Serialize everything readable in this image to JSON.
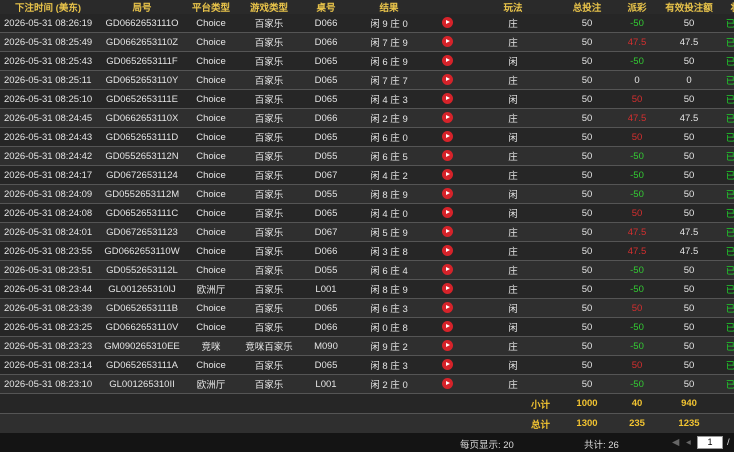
{
  "columns": [
    "下注时间 (美东)",
    "局号",
    "平台类型",
    "游戏类型",
    "桌号",
    "结果",
    "",
    "玩法",
    "总投注",
    "派彩",
    "有效投注额",
    "状态"
  ],
  "rows": [
    {
      "time": "2026-05-31 08:26:19",
      "round": "GD0662653111O",
      "platform": "Choice",
      "game": "百家乐",
      "table": "D066",
      "result": "闲 9 庄 0",
      "play": "庄",
      "bet": "50",
      "payout": "-50",
      "payout_sign": "pos",
      "valid": "50",
      "status": "已派彩"
    },
    {
      "time": "2026-05-31 08:25:49",
      "round": "GD0662653110Z",
      "platform": "Choice",
      "game": "百家乐",
      "table": "D066",
      "result": "闲 7 庄 9",
      "play": "庄",
      "bet": "50",
      "payout": "47.5",
      "payout_sign": "neg",
      "valid": "47.5",
      "status": "已派彩"
    },
    {
      "time": "2026-05-31 08:25:43",
      "round": "GD0652653111F",
      "platform": "Choice",
      "game": "百家乐",
      "table": "D065",
      "result": "闲 6 庄 9",
      "play": "闲",
      "bet": "50",
      "payout": "-50",
      "payout_sign": "pos",
      "valid": "50",
      "status": "已派彩"
    },
    {
      "time": "2026-05-31 08:25:11",
      "round": "GD0652653110Y",
      "platform": "Choice",
      "game": "百家乐",
      "table": "D065",
      "result": "闲 7 庄 7",
      "play": "庄",
      "bet": "50",
      "payout": "0",
      "payout_sign": "zero",
      "valid": "0",
      "status": "已派彩"
    },
    {
      "time": "2026-05-31 08:25:10",
      "round": "GD0652653111E",
      "platform": "Choice",
      "game": "百家乐",
      "table": "D065",
      "result": "闲 4 庄 3",
      "play": "闲",
      "bet": "50",
      "payout": "50",
      "payout_sign": "neg",
      "valid": "50",
      "status": "已派彩"
    },
    {
      "time": "2026-05-31 08:24:45",
      "round": "GD0662653110X",
      "platform": "Choice",
      "game": "百家乐",
      "table": "D066",
      "result": "闲 2 庄 9",
      "play": "庄",
      "bet": "50",
      "payout": "47.5",
      "payout_sign": "neg",
      "valid": "47.5",
      "status": "已派彩"
    },
    {
      "time": "2026-05-31 08:24:43",
      "round": "GD0652653111D",
      "platform": "Choice",
      "game": "百家乐",
      "table": "D065",
      "result": "闲 6 庄 0",
      "play": "闲",
      "bet": "50",
      "payout": "50",
      "payout_sign": "neg",
      "valid": "50",
      "status": "已派彩"
    },
    {
      "time": "2026-05-31 08:24:42",
      "round": "GD0552653112N",
      "platform": "Choice",
      "game": "百家乐",
      "table": "D055",
      "result": "闲 6 庄 5",
      "play": "庄",
      "bet": "50",
      "payout": "-50",
      "payout_sign": "pos",
      "valid": "50",
      "status": "已派彩"
    },
    {
      "time": "2026-05-31 08:24:17",
      "round": "GD0672653112​4",
      "platform": "Choice",
      "game": "百家乐",
      "table": "D067",
      "result": "闲 4 庄 2",
      "play": "庄",
      "bet": "50",
      "payout": "-50",
      "payout_sign": "pos",
      "valid": "50",
      "status": "已派彩"
    },
    {
      "time": "2026-05-31 08:24:09",
      "round": "GD0552653112M",
      "platform": "Choice",
      "game": "百家乐",
      "table": "D055",
      "result": "闲 8 庄 9",
      "play": "闲",
      "bet": "50",
      "payout": "-50",
      "payout_sign": "pos",
      "valid": "50",
      "status": "已派彩"
    },
    {
      "time": "2026-05-31 08:24:08",
      "round": "GD0652653111C",
      "platform": "Choice",
      "game": "百家乐",
      "table": "D065",
      "result": "闲 4 庄 0",
      "play": "闲",
      "bet": "50",
      "payout": "50",
      "payout_sign": "neg",
      "valid": "50",
      "status": "已派彩"
    },
    {
      "time": "2026-05-31 08:24:01",
      "round": "GD0672653112​3",
      "platform": "Choice",
      "game": "百家乐",
      "table": "D067",
      "result": "闲 5 庄 9",
      "play": "庄",
      "bet": "50",
      "payout": "47.5",
      "payout_sign": "neg",
      "valid": "47.5",
      "status": "已派彩"
    },
    {
      "time": "2026-05-31 08:23:55",
      "round": "GD0662653110W",
      "platform": "Choice",
      "game": "百家乐",
      "table": "D066",
      "result": "闲 3 庄 8",
      "play": "庄",
      "bet": "50",
      "payout": "47.5",
      "payout_sign": "neg",
      "valid": "47.5",
      "status": "已派彩"
    },
    {
      "time": "2026-05-31 08:23:51",
      "round": "GD0552653112L",
      "platform": "Choice",
      "game": "百家乐",
      "table": "D055",
      "result": "闲 6 庄 4",
      "play": "庄",
      "bet": "50",
      "payout": "-50",
      "payout_sign": "pos",
      "valid": "50",
      "status": "已派彩"
    },
    {
      "time": "2026-05-31 08:23:44",
      "round": "GL00126531​0IJ",
      "platform": "欧洲厅",
      "game": "百家乐",
      "table": "L001",
      "result": "闲 8 庄 9",
      "play": "庄",
      "bet": "50",
      "payout": "-50",
      "payout_sign": "pos",
      "valid": "50",
      "status": "已派彩"
    },
    {
      "time": "2026-05-31 08:23:39",
      "round": "GD0652653111B",
      "platform": "Choice",
      "game": "百家乐",
      "table": "D065",
      "result": "闲 6 庄 3",
      "play": "闲",
      "bet": "50",
      "payout": "50",
      "payout_sign": "neg",
      "valid": "50",
      "status": "已派彩"
    },
    {
      "time": "2026-05-31 08:23:25",
      "round": "GD0662653110V",
      "platform": "Choice",
      "game": "百家乐",
      "table": "D066",
      "result": "闲 0 庄 8",
      "play": "闲",
      "bet": "50",
      "payout": "-50",
      "payout_sign": "pos",
      "valid": "50",
      "status": "已派彩"
    },
    {
      "time": "2026-05-31 08:23:23",
      "round": "GM0902653​10EE",
      "platform": "竞咪",
      "game": "竞咪百家乐",
      "table": "M090",
      "result": "闲 9 庄 2",
      "play": "庄",
      "bet": "50",
      "payout": "-50",
      "payout_sign": "pos",
      "valid": "50",
      "status": "已派彩"
    },
    {
      "time": "2026-05-31 08:23:14",
      "round": "GD0652653111A",
      "platform": "Choice",
      "game": "百家乐",
      "table": "D065",
      "result": "闲 8 庄 3",
      "play": "闲",
      "bet": "50",
      "payout": "50",
      "payout_sign": "neg",
      "valid": "50",
      "status": "已派彩"
    },
    {
      "time": "2026-05-31 08:23:10",
      "round": "GL00126531​0II",
      "platform": "欧洲厅",
      "game": "百家乐",
      "table": "L001",
      "result": "闲 2 庄 0",
      "play": "庄",
      "bet": "50",
      "payout": "-50",
      "payout_sign": "pos",
      "valid": "50",
      "status": "已派彩"
    }
  ],
  "subtotal": {
    "label": "小计",
    "bet": "1000",
    "payout": "40",
    "valid": "940"
  },
  "total": {
    "label": "总计",
    "bet": "1300",
    "payout": "235",
    "valid": "1235"
  },
  "pager": {
    "per_page": "每页显示: 20",
    "total": "共计: 26",
    "page": "1",
    "slash": "/"
  },
  "colors": {
    "header_text": "#e8c34a",
    "win": "#33cc33",
    "loss": "#d62f2f",
    "status": "#1fcf2a"
  }
}
